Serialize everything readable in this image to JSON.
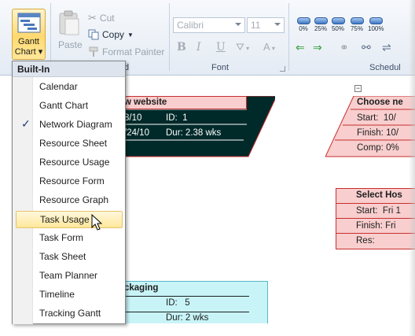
{
  "ribbon": {
    "gantt_chart_label_line1": "Gantt",
    "gantt_chart_label_line2": "Chart",
    "paste_label": "Paste",
    "cut_label": "Cut",
    "copy_label": "Copy",
    "format_painter_label": "Format Painter",
    "clipboard_group_label_partial": "d",
    "font_name": "Calibri",
    "font_size": "11",
    "bold_label": "B",
    "italic_label": "I",
    "underline_label": "U",
    "font_group_label": "Font",
    "schedule_group_label_partial": "Schedul",
    "percent_buttons": [
      "0%",
      "25%",
      "50%",
      "75%",
      "100%"
    ]
  },
  "view_menu": {
    "header": "Built-In",
    "items": [
      {
        "label": "Calendar",
        "checked": false,
        "hovered": false
      },
      {
        "label": "Gantt Chart",
        "checked": false,
        "hovered": false
      },
      {
        "label": "Network Diagram",
        "checked": true,
        "hovered": false
      },
      {
        "label": "Resource Sheet",
        "checked": false,
        "hovered": false
      },
      {
        "label": "Resource Usage",
        "checked": false,
        "hovered": false
      },
      {
        "label": "Resource Form",
        "checked": false,
        "hovered": false
      },
      {
        "label": "Resource Graph",
        "checked": false,
        "hovered": false
      },
      {
        "label": "Task Usage",
        "checked": false,
        "hovered": true
      },
      {
        "label": "Task Form",
        "checked": false,
        "hovered": false
      },
      {
        "label": "Task Sheet",
        "checked": false,
        "hovered": false
      },
      {
        "label": "Team Planner",
        "checked": false,
        "hovered": false
      },
      {
        "label": "Timeline",
        "checked": false,
        "hovered": false
      },
      {
        "label": "Tracking Gantt",
        "checked": false,
        "hovered": false
      }
    ]
  },
  "network": {
    "node_website": {
      "title": "w website",
      "row1_left": "8/10",
      "row1_right": "ID:  1",
      "row2_left": "/24/10",
      "row2_right": "Dur: 2.38 wks"
    },
    "node_choose": {
      "title": "Choose ne",
      "start": "Start:  10/",
      "finish": "Finish: 10/",
      "comp": "Comp: 0%"
    },
    "node_select": {
      "title": "Select Hos",
      "start": "Start:  Fri 1",
      "finish": "Finish: Fri",
      "res": "Res:"
    },
    "node_packaging": {
      "title": "ckaging",
      "id": "ID:   5",
      "dur": "Dur: 2 wks"
    },
    "collapse_glyph": "−"
  },
  "colors": {
    "accent_hover": "#ffe79b",
    "node_dark": "#002a2a",
    "node_pink": "#f8cece",
    "node_cyan": "#c8f4f8",
    "node_border_red": "#c82e2e",
    "menu_check": "#1f3f7a"
  }
}
